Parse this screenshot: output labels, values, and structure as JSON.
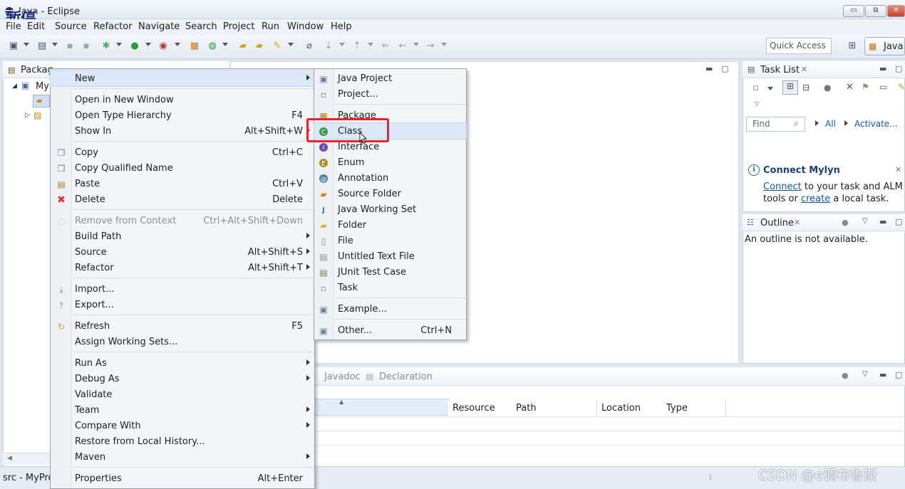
{
  "window": {
    "title": "Java - Eclipse",
    "overlay_text": "暂停",
    "buttons": [
      "▭",
      "⧉",
      "✕"
    ]
  },
  "menubar": [
    "File",
    "Edit",
    "Source",
    "Refactor",
    "Navigate",
    "Search",
    "Project",
    "Run",
    "Window",
    "Help"
  ],
  "toolbar": {
    "quick_access": "Quick Access",
    "perspective": "Java"
  },
  "package_explorer": {
    "tab_label": "Packag",
    "tree_item_1": "My",
    "status_text": "src - MyPro"
  },
  "context_menu": {
    "items": [
      {
        "label": "New",
        "shortcut": "",
        "arrow": true
      },
      {
        "label": "Open in New Window",
        "shortcut": ""
      },
      {
        "label": "Open Type Hierarchy",
        "shortcut": "F4"
      },
      {
        "label": "Show In",
        "shortcut": "Alt+Shift+W",
        "arrow": true
      },
      {
        "label": "Copy",
        "shortcut": "Ctrl+C"
      },
      {
        "label": "Copy Qualified Name",
        "shortcut": ""
      },
      {
        "label": "Paste",
        "shortcut": "Ctrl+V"
      },
      {
        "label": "Delete",
        "shortcut": "Delete"
      },
      {
        "label": "Remove from Context",
        "shortcut": "Ctrl+Alt+Shift+Down",
        "disabled": true
      },
      {
        "label": "Build Path",
        "shortcut": "",
        "arrow": true
      },
      {
        "label": "Source",
        "shortcut": "Alt+Shift+S",
        "arrow": true
      },
      {
        "label": "Refactor",
        "shortcut": "Alt+Shift+T",
        "arrow": true
      },
      {
        "label": "Import...",
        "shortcut": ""
      },
      {
        "label": "Export...",
        "shortcut": ""
      },
      {
        "label": "Refresh",
        "shortcut": "F5"
      },
      {
        "label": "Assign Working Sets...",
        "shortcut": ""
      },
      {
        "label": "Run As",
        "shortcut": "",
        "arrow": true
      },
      {
        "label": "Debug As",
        "shortcut": "",
        "arrow": true
      },
      {
        "label": "Validate",
        "shortcut": ""
      },
      {
        "label": "Team",
        "shortcut": "",
        "arrow": true
      },
      {
        "label": "Compare With",
        "shortcut": "",
        "arrow": true
      },
      {
        "label": "Restore from Local History...",
        "shortcut": ""
      },
      {
        "label": "Maven",
        "shortcut": "",
        "arrow": true
      },
      {
        "label": "Properties",
        "shortcut": "Alt+Enter"
      }
    ]
  },
  "new_submenu": {
    "items": [
      {
        "label": "Java Project",
        "shortcut": ""
      },
      {
        "label": "Project...",
        "shortcut": ""
      },
      {
        "label": "Package",
        "shortcut": ""
      },
      {
        "label": "Class",
        "shortcut": ""
      },
      {
        "label": "Interface",
        "shortcut": ""
      },
      {
        "label": "Enum",
        "shortcut": ""
      },
      {
        "label": "Annotation",
        "shortcut": ""
      },
      {
        "label": "Source Folder",
        "shortcut": ""
      },
      {
        "label": "Java Working Set",
        "shortcut": ""
      },
      {
        "label": "Folder",
        "shortcut": ""
      },
      {
        "label": "File",
        "shortcut": ""
      },
      {
        "label": "Untitled Text File",
        "shortcut": ""
      },
      {
        "label": "JUnit Test Case",
        "shortcut": ""
      },
      {
        "label": "Task",
        "shortcut": ""
      },
      {
        "label": "Example...",
        "shortcut": ""
      },
      {
        "label": "Other...",
        "shortcut": "Ctrl+N"
      }
    ]
  },
  "task_list": {
    "tab_label": "Task List",
    "find_placeholder": "Find",
    "all_label": "All",
    "activate_label": "Activate..."
  },
  "mylyn": {
    "title": "Connect Mylyn",
    "connect_link": "Connect",
    "line1_rest": " to your task and ALM",
    "line2_prefix": "tools or ",
    "create_link": "create",
    "line2_suffix": " a local task."
  },
  "outline": {
    "tab_label": "Outline",
    "message": "An outline is not available."
  },
  "bottom_panel": {
    "tabs": [
      "Javadoc",
      "Declaration"
    ],
    "columns": [
      "Resource",
      "Path",
      "Location",
      "Type"
    ]
  },
  "watermark": "CSDN @e调布鲁斯",
  "colors": {
    "highlight_red": "#e8232a",
    "link_blue": "#1155aa",
    "menu_highlight": "#dce8f7"
  }
}
